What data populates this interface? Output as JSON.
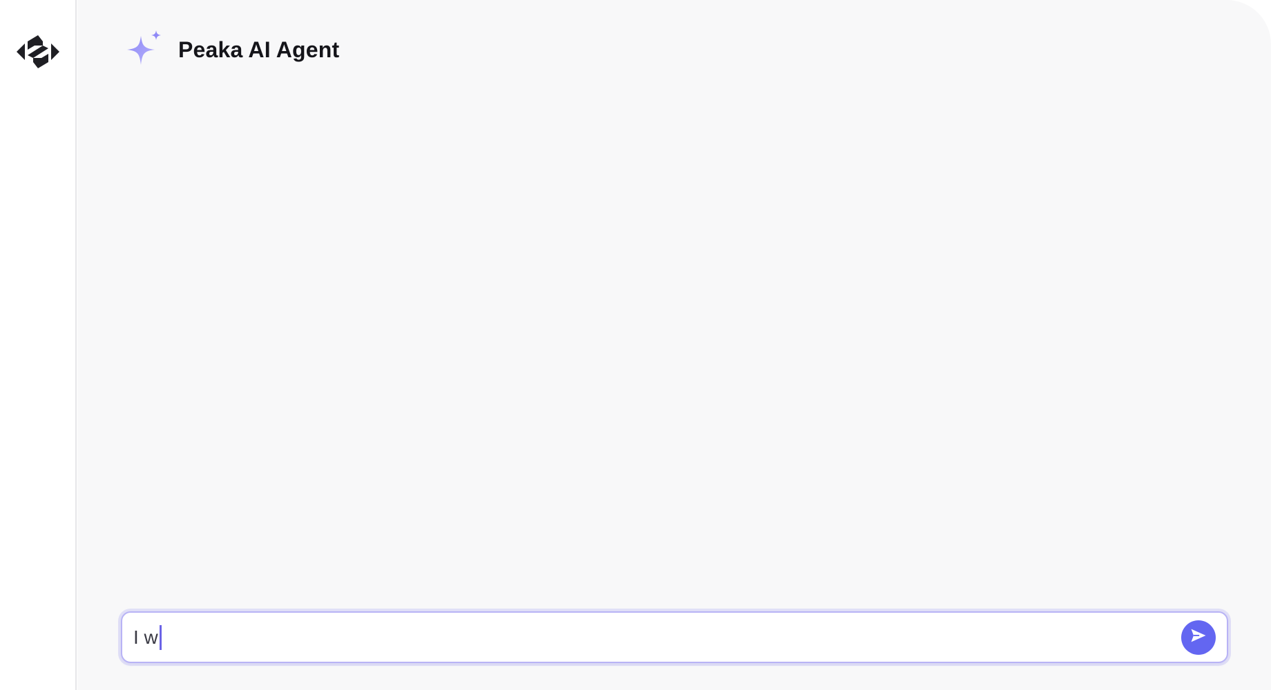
{
  "app": {
    "title": "Peaka AI Agent",
    "logo_icon": "peaka-logo-icon",
    "header_icon": "sparkle-icon"
  },
  "composer": {
    "value": "I w",
    "send_icon": "send-icon"
  },
  "colors": {
    "accent": "#6366f1",
    "sparkle_light": "#a5a1fb",
    "sparkle_dark": "#7a72f0",
    "logo": "#1f1f24"
  }
}
